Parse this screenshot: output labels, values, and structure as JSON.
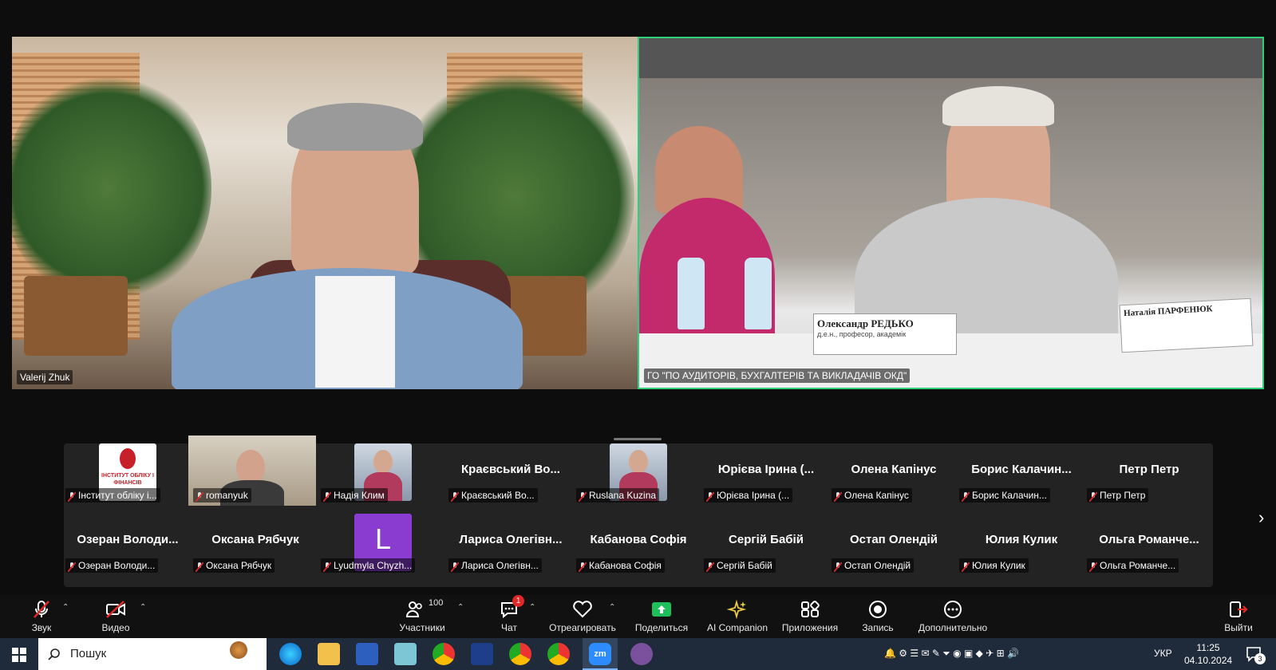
{
  "videos": [
    {
      "name": "Valerij Zhuk"
    },
    {
      "name": "ГО \"ПО АУДИТОРІВ, БУХГАЛТЕРІВ ТА ВИКЛАДАЧІВ ОКД\""
    }
  ],
  "name_cards": {
    "card1": "Олександр РЕДЬКО",
    "card1_sub": "д.е.н., професор, академік",
    "card2": "Наталія ПАРФЕНЮК"
  },
  "gallery": {
    "row1": [
      {
        "type": "image",
        "name": "Інститут обліку і...",
        "logo_text": "ІНСТИТУТ ОБЛІКУ І ФІНАНСІВ"
      },
      {
        "type": "video",
        "name": "romanyuk"
      },
      {
        "type": "image",
        "name": "Надія Клим"
      },
      {
        "type": "text",
        "big": "Краєвський Во...",
        "name": "Краєвський Во..."
      },
      {
        "type": "image",
        "name": "Ruslana Kuzina"
      },
      {
        "type": "text",
        "big": "Юрієва Ірина (...",
        "name": "Юрієва Ірина (..."
      },
      {
        "type": "text",
        "big": "Олена Капінус",
        "name": "Олена Капінус"
      },
      {
        "type": "text",
        "big": "Борис Калачин...",
        "name": "Борис Калачин..."
      },
      {
        "type": "text",
        "big": "Петр Петр",
        "name": "Петр Петр"
      }
    ],
    "row2": [
      {
        "type": "text",
        "big": "Озеран Володи...",
        "name": "Озеран Володи..."
      },
      {
        "type": "text",
        "big": "Оксана Рябчук",
        "name": "Оксана Рябчук"
      },
      {
        "type": "letter",
        "letter": "L",
        "name": "Lyudmyla Chyzh..."
      },
      {
        "type": "text",
        "big": "Лариса Олегівн...",
        "name": "Лариса Олегівн..."
      },
      {
        "type": "text",
        "big": "Кабанова Софія",
        "name": "Кабанова Софія"
      },
      {
        "type": "text",
        "big": "Сергій Бабій",
        "name": "Сергій Бабій"
      },
      {
        "type": "text",
        "big": "Остап Олендій",
        "name": "Остап Олендій"
      },
      {
        "type": "text",
        "big": "Юлия Кулик",
        "name": "Юлия Кулик"
      },
      {
        "type": "text",
        "big": "Ольга Романче...",
        "name": "Ольга Романче..."
      }
    ],
    "next_icon": "chevron-right-icon"
  },
  "toolbar": {
    "audio": "Звук",
    "video": "Видео",
    "participants": "Участники",
    "participants_count": "100",
    "chat": "Чат",
    "chat_badge": "1",
    "react": "Отреагировать",
    "share": "Поделиться",
    "ai": "AI Companion",
    "apps": "Приложения",
    "record": "Запись",
    "more": "Дополнительно",
    "leave": "Выйти"
  },
  "taskbar": {
    "search_placeholder": "Пошук",
    "lang": "УКР",
    "time": "11:25",
    "date": "04.10.2024",
    "notif_count": "3"
  },
  "colors": {
    "active_speaker": "#2ed07a",
    "share_green": "#1fc05b",
    "leave_red": "#e02828",
    "mute_red": "#e02828"
  }
}
